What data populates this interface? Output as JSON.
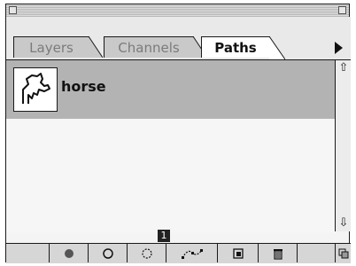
{
  "tabs": [
    {
      "label": "Layers",
      "active": false
    },
    {
      "label": "Channels",
      "active": false
    },
    {
      "label": "Paths",
      "active": true
    }
  ],
  "paths": [
    {
      "name": "horse",
      "selected": true,
      "thumbnail_icon": "horse-path-icon"
    }
  ],
  "status_badge": "1",
  "bottom_buttons": [
    {
      "icon": "fill-path-icon"
    },
    {
      "icon": "stroke-path-icon"
    },
    {
      "icon": "load-selection-icon"
    },
    {
      "icon": "make-work-path-icon"
    },
    {
      "icon": "new-path-icon"
    },
    {
      "icon": "delete-path-icon"
    }
  ],
  "colors": {
    "selected_row": "#b3b3b3",
    "inactive_tab": "#c9c9c9"
  }
}
